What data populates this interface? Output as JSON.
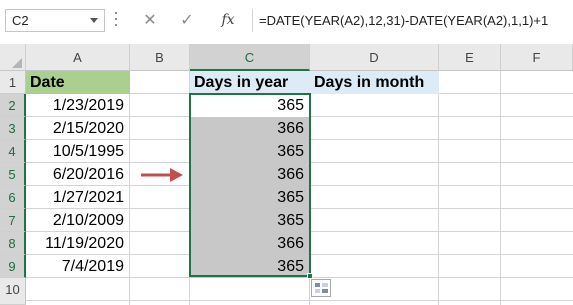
{
  "formula_bar": {
    "name_box": "C2",
    "cancel_glyph": "✕",
    "enter_glyph": "✓",
    "fx_label": "fx",
    "formula": "=DATE(YEAR(A2),12,31)-DATE(YEAR(A2),1,1)+1"
  },
  "columns": [
    "A",
    "B",
    "C",
    "D",
    "E",
    "F"
  ],
  "rows": [
    "1",
    "2",
    "3",
    "4",
    "5",
    "6",
    "7",
    "8",
    "9",
    "10"
  ],
  "sheet": {
    "a_header": "Date",
    "c_header": "Days in year",
    "d_header": "Days in month",
    "dates": [
      "1/23/2019",
      "2/15/2020",
      "10/5/1995",
      "6/20/2016",
      "1/27/2021",
      "2/10/2009",
      "11/19/2020",
      "7/4/2019"
    ],
    "days_in_year": [
      "365",
      "366",
      "365",
      "366",
      "365",
      "365",
      "366",
      "365"
    ]
  },
  "colors": {
    "date_header_fill": "#a9d08e",
    "days_header_fill": "#ddebf7",
    "selection_fill": "#c8c8c8",
    "selection_border": "#217346",
    "arrow": "#c0504d"
  },
  "icons": {
    "arrow": "right-arrow-icon",
    "quick_analysis": "quick-analysis-icon",
    "name_box_dropdown": "chevron-down-icon"
  }
}
